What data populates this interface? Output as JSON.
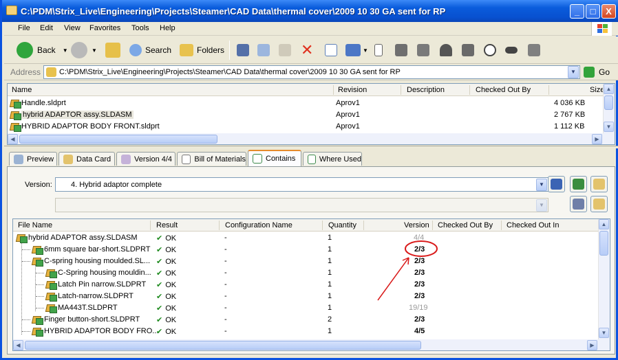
{
  "window": {
    "title": "C:\\PDM\\Strix_Live\\Engineering\\Projects\\Steamer\\CAD Data\\thermal cover\\2009 10 30 GA sent for RP",
    "minimize": "_",
    "maximize": "□",
    "close": "X"
  },
  "menu": [
    "File",
    "Edit",
    "View",
    "Favorites",
    "Tools",
    "Help"
  ],
  "toolbar": {
    "back": "Back",
    "search": "Search",
    "folders": "Folders"
  },
  "address": {
    "label": "Address",
    "value": "C:\\PDM\\Strix_Live\\Engineering\\Projects\\Steamer\\CAD Data\\thermal cover\\2009 10 30 GA sent for RP",
    "go": "Go"
  },
  "file_list": {
    "columns": [
      "Name",
      "Revision",
      "Description",
      "Checked Out By",
      "Size"
    ],
    "rows": [
      {
        "name": "Handle.sldprt",
        "revision": "Aprov1",
        "description": "",
        "checked_out_by": "",
        "size": "4 036 KB"
      },
      {
        "name": "hybrid ADAPTOR assy.SLDASM",
        "revision": "Aprov1",
        "description": "",
        "checked_out_by": "",
        "size": "2 767 KB"
      },
      {
        "name": "HYBRID ADAPTOR BODY FRONT.sldprt",
        "revision": "Aprov1",
        "description": "",
        "checked_out_by": "",
        "size": "1 112 KB"
      }
    ]
  },
  "tabs": [
    {
      "label": "Preview",
      "icon": "preview-icon"
    },
    {
      "label": "Data Card",
      "icon": "data-card-icon"
    },
    {
      "label": "Version 4/4",
      "icon": "version-icon"
    },
    {
      "label": "Bill of Materials",
      "icon": "bom-icon"
    },
    {
      "label": "Contains",
      "icon": "contains-icon",
      "active": true
    },
    {
      "label": "Where Used",
      "icon": "where-used-icon"
    }
  ],
  "contains": {
    "version_label": "Version:",
    "version_value": "4. Hybrid adaptor complete",
    "columns": [
      "File Name",
      "Result",
      "Configuration Name",
      "Quantity",
      "Version",
      "Checked Out By",
      "Checked Out In"
    ],
    "rows": [
      {
        "name": "hybrid ADAPTOR assy.SLDASM",
        "result": "OK",
        "config": "-",
        "qty": "1",
        "version": "4/4"
      },
      {
        "name": "6mm square bar-short.SLDPRT",
        "result": "OK",
        "config": "-",
        "qty": "1",
        "version": "2/3"
      },
      {
        "name": "C-spring housing moulded.SL...",
        "result": "OK",
        "config": "-",
        "qty": "1",
        "version": "2/3"
      },
      {
        "name": "C-Spring housing mouldin...",
        "result": "OK",
        "config": "-",
        "qty": "1",
        "version": "2/3"
      },
      {
        "name": "Latch Pin narrow.SLDPRT",
        "result": "OK",
        "config": "-",
        "qty": "1",
        "version": "2/3"
      },
      {
        "name": "Latch-narrow.SLDPRT",
        "result": "OK",
        "config": "-",
        "qty": "1",
        "version": "2/3"
      },
      {
        "name": "MA443T.SLDPRT",
        "result": "OK",
        "config": "-",
        "qty": "1",
        "version": "19/19"
      },
      {
        "name": "Finger button-short.SLDPRT",
        "result": "OK",
        "config": "-",
        "qty": "2",
        "version": "2/3"
      },
      {
        "name": "HYBRID ADAPTOR BODY FRO...",
        "result": "OK",
        "config": "-",
        "qty": "1",
        "version": "4/5"
      }
    ]
  },
  "colors": {
    "titlebar": "#0a5cdc",
    "annotation": "#d91a1a",
    "ok_check": "#1e8a1e"
  }
}
